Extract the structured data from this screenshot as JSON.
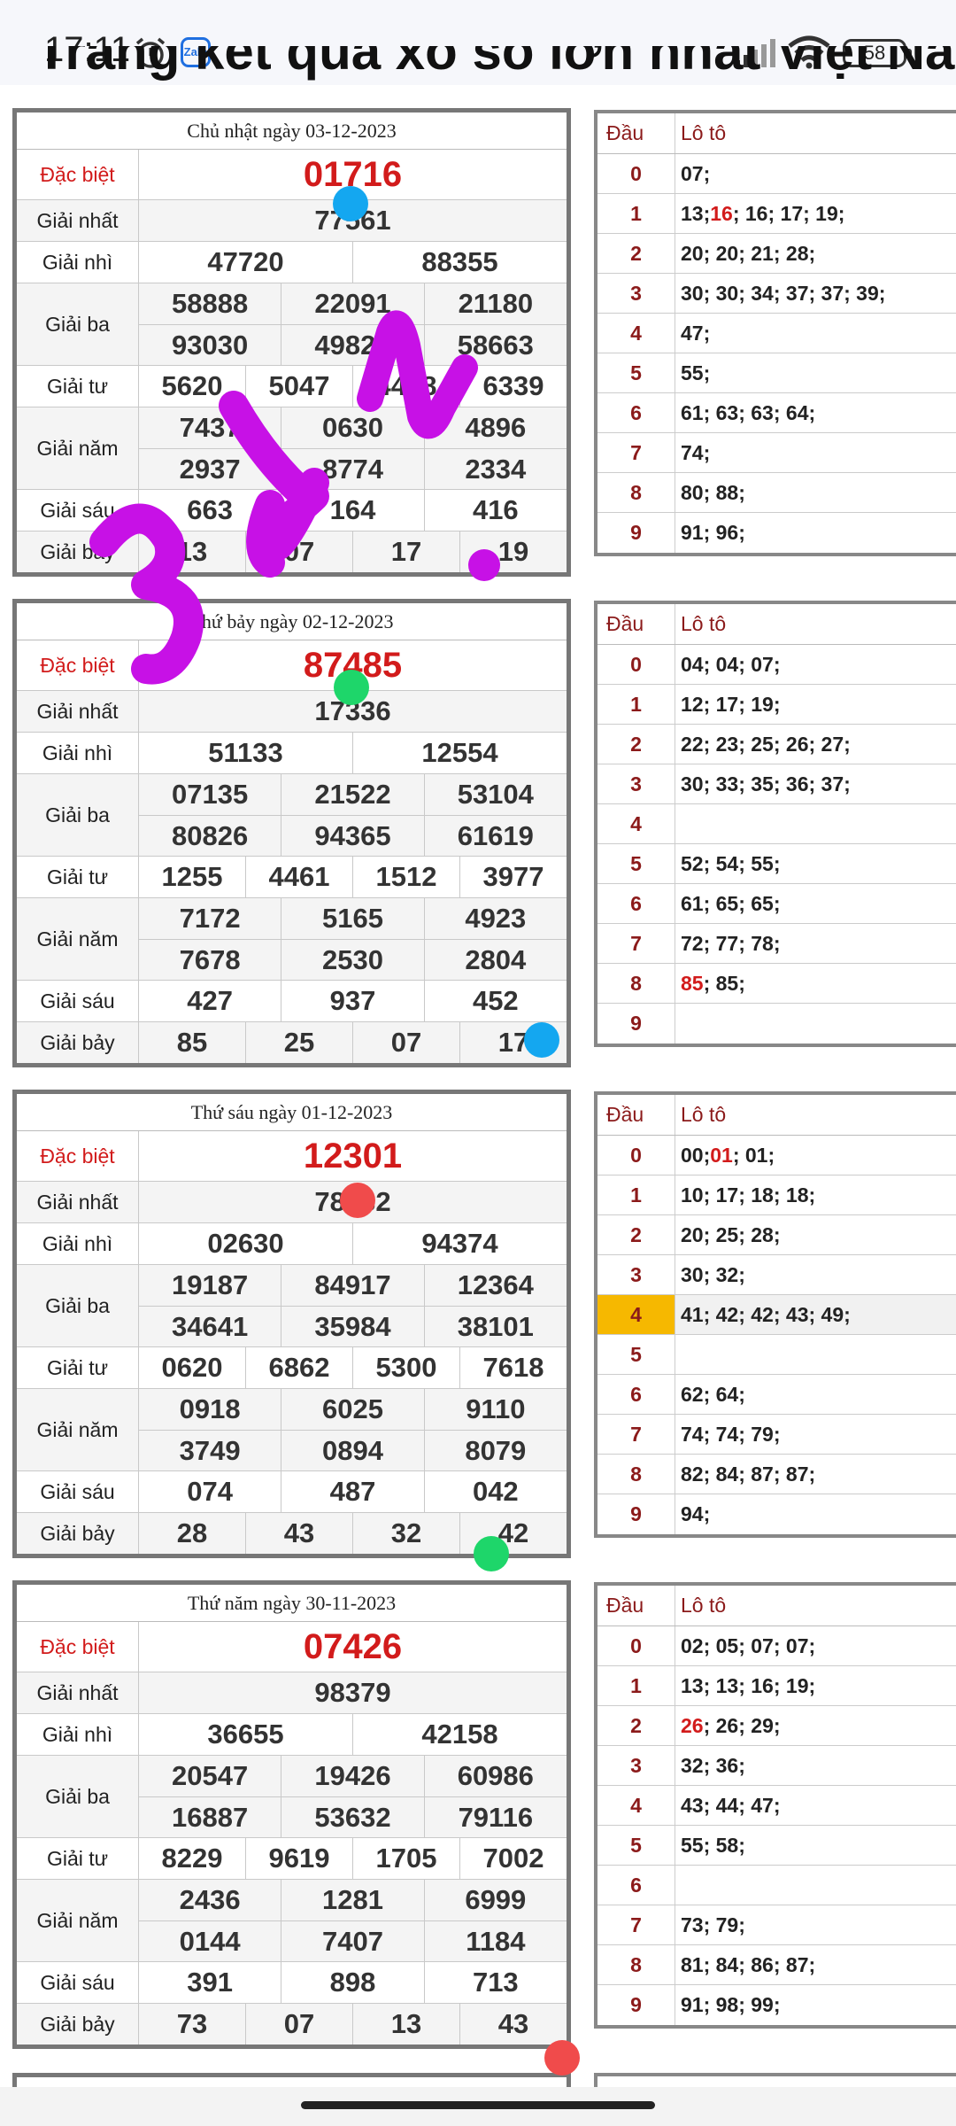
{
  "status_bar": {
    "time": "17:11",
    "battery": "58",
    "zalo_label": "Zalo"
  },
  "page_heading": "Trang kết quả xổ số lớn nhất Việt Nam",
  "loto_header": {
    "dau": "Đầu",
    "loto": "Lô tô"
  },
  "draws": [
    {
      "date": "Chủ nhật ngày 03-12-2023",
      "prizes": [
        {
          "label": "Đặc biệt",
          "rows": [
            [
              "01716"
            ]
          ]
        },
        {
          "label": "Giải nhất",
          "rows": [
            [
              "77561"
            ]
          ]
        },
        {
          "label": "Giải nhì",
          "rows": [
            [
              "47720",
              "88355"
            ]
          ]
        },
        {
          "label": "Giải ba",
          "rows": [
            [
              "58888",
              "22091",
              "21180"
            ],
            [
              "93030",
              "49829",
              "58663"
            ]
          ]
        },
        {
          "label": "Giải tư",
          "rows": [
            [
              "5620",
              "5047",
              "4468",
              "6339"
            ]
          ]
        },
        {
          "label": "Giải năm",
          "rows": [
            [
              "7437",
              "0630",
              "4896"
            ],
            [
              "2937",
              "8774",
              "2334"
            ]
          ]
        },
        {
          "label": "Giải sáu",
          "rows": [
            [
              "663",
              "164",
              "416"
            ]
          ]
        },
        {
          "label": "Giải bảy",
          "rows": [
            [
              "13",
              "07",
              "17",
              "19"
            ]
          ]
        }
      ],
      "loto": [
        {
          "d": "0",
          "v": [
            [
              "07;",
              false
            ]
          ]
        },
        {
          "d": "1",
          "v": [
            [
              "13; ",
              false
            ],
            [
              "16",
              true
            ],
            [
              "; 16; 17; 19;",
              false
            ]
          ]
        },
        {
          "d": "2",
          "v": [
            [
              "20; 20; 21; 28;",
              false
            ]
          ]
        },
        {
          "d": "3",
          "v": [
            [
              "30; 30; 34; 37; 37; 39;",
              false
            ]
          ]
        },
        {
          "d": "4",
          "v": [
            [
              "47;",
              false
            ]
          ]
        },
        {
          "d": "5",
          "v": [
            [
              "55;",
              false
            ]
          ]
        },
        {
          "d": "6",
          "v": [
            [
              "61; 63; 63; 64;",
              false
            ]
          ]
        },
        {
          "d": "7",
          "v": [
            [
              "74;",
              false
            ]
          ]
        },
        {
          "d": "8",
          "v": [
            [
              "80; 88;",
              false
            ]
          ]
        },
        {
          "d": "9",
          "v": [
            [
              "91; 96;",
              false
            ]
          ]
        }
      ]
    },
    {
      "date": "Thứ bảy ngày 02-12-2023",
      "prizes": [
        {
          "label": "Đặc biệt",
          "rows": [
            [
              "87485"
            ]
          ]
        },
        {
          "label": "Giải nhất",
          "rows": [
            [
              "17336"
            ]
          ]
        },
        {
          "label": "Giải nhì",
          "rows": [
            [
              "51133",
              "12554"
            ]
          ]
        },
        {
          "label": "Giải ba",
          "rows": [
            [
              "07135",
              "21522",
              "53104"
            ],
            [
              "80826",
              "94365",
              "61619"
            ]
          ]
        },
        {
          "label": "Giải tư",
          "rows": [
            [
              "1255",
              "4461",
              "1512",
              "3977"
            ]
          ]
        },
        {
          "label": "Giải năm",
          "rows": [
            [
              "7172",
              "5165",
              "4923"
            ],
            [
              "7678",
              "2530",
              "2804"
            ]
          ]
        },
        {
          "label": "Giải sáu",
          "rows": [
            [
              "427",
              "937",
              "452"
            ]
          ]
        },
        {
          "label": "Giải bảy",
          "rows": [
            [
              "85",
              "25",
              "07",
              "17"
            ]
          ]
        }
      ],
      "loto": [
        {
          "d": "0",
          "v": [
            [
              "04; 04; 07;",
              false
            ]
          ]
        },
        {
          "d": "1",
          "v": [
            [
              "12; 17; 19;",
              false
            ]
          ]
        },
        {
          "d": "2",
          "v": [
            [
              "22; 23; 25; 26; 27;",
              false
            ]
          ]
        },
        {
          "d": "3",
          "v": [
            [
              "30; 33; 35; 36; 37;",
              false
            ]
          ]
        },
        {
          "d": "4",
          "v": []
        },
        {
          "d": "5",
          "v": [
            [
              "52; 54; 55;",
              false
            ]
          ]
        },
        {
          "d": "6",
          "v": [
            [
              "61; 65; 65;",
              false
            ]
          ]
        },
        {
          "d": "7",
          "v": [
            [
              "72; 77; 78;",
              false
            ]
          ]
        },
        {
          "d": "8",
          "v": [
            [
              "85",
              true
            ],
            [
              "; 85;",
              false
            ]
          ]
        },
        {
          "d": "9",
          "v": []
        }
      ]
    },
    {
      "date": "Thứ sáu ngày 01-12-2023",
      "prizes": [
        {
          "label": "Đặc biệt",
          "rows": [
            [
              "12301"
            ]
          ]
        },
        {
          "label": "Giải nhất",
          "rows": [
            [
              "78432"
            ]
          ]
        },
        {
          "label": "Giải nhì",
          "rows": [
            [
              "02630",
              "94374"
            ]
          ]
        },
        {
          "label": "Giải ba",
          "rows": [
            [
              "19187",
              "84917",
              "12364"
            ],
            [
              "34641",
              "35984",
              "38101"
            ]
          ]
        },
        {
          "label": "Giải tư",
          "rows": [
            [
              "0620",
              "6862",
              "5300",
              "7618"
            ]
          ]
        },
        {
          "label": "Giải năm",
          "rows": [
            [
              "0918",
              "6025",
              "9110"
            ],
            [
              "3749",
              "0894",
              "8079"
            ]
          ]
        },
        {
          "label": "Giải sáu",
          "rows": [
            [
              "074",
              "487",
              "042"
            ]
          ]
        },
        {
          "label": "Giải bảy",
          "rows": [
            [
              "28",
              "43",
              "32",
              "42"
            ]
          ]
        }
      ],
      "loto": [
        {
          "d": "0",
          "v": [
            [
              "00; ",
              false
            ],
            [
              "01",
              true
            ],
            [
              "; 01;",
              false
            ]
          ]
        },
        {
          "d": "1",
          "v": [
            [
              "10; 17; 18; 18;",
              false
            ]
          ]
        },
        {
          "d": "2",
          "v": [
            [
              "20; 25; 28;",
              false
            ]
          ]
        },
        {
          "d": "3",
          "v": [
            [
              "30; 32;",
              false
            ]
          ]
        },
        {
          "d": "4",
          "v": [
            [
              "41; 42; 42; 43; 49;",
              false
            ]
          ],
          "active": true
        },
        {
          "d": "5",
          "v": []
        },
        {
          "d": "6",
          "v": [
            [
              "62; 64;",
              false
            ]
          ]
        },
        {
          "d": "7",
          "v": [
            [
              "74; 74; 79;",
              false
            ]
          ]
        },
        {
          "d": "8",
          "v": [
            [
              "82; 84; 87; 87;",
              false
            ]
          ]
        },
        {
          "d": "9",
          "v": [
            [
              "94;",
              false
            ]
          ]
        }
      ]
    },
    {
      "date": "Thứ năm ngày 30-11-2023",
      "prizes": [
        {
          "label": "Đặc biệt",
          "rows": [
            [
              "07426"
            ]
          ]
        },
        {
          "label": "Giải nhất",
          "rows": [
            [
              "98379"
            ]
          ]
        },
        {
          "label": "Giải nhì",
          "rows": [
            [
              "36655",
              "42158"
            ]
          ]
        },
        {
          "label": "Giải ba",
          "rows": [
            [
              "20547",
              "19426",
              "60986"
            ],
            [
              "16887",
              "53632",
              "79116"
            ]
          ]
        },
        {
          "label": "Giải tư",
          "rows": [
            [
              "8229",
              "9619",
              "1705",
              "7002"
            ]
          ]
        },
        {
          "label": "Giải năm",
          "rows": [
            [
              "2436",
              "1281",
              "6999"
            ],
            [
              "0144",
              "7407",
              "1184"
            ]
          ]
        },
        {
          "label": "Giải sáu",
          "rows": [
            [
              "391",
              "898",
              "713"
            ]
          ]
        },
        {
          "label": "Giải bảy",
          "rows": [
            [
              "73",
              "07",
              "13",
              "43"
            ]
          ]
        }
      ],
      "loto": [
        {
          "d": "0",
          "v": [
            [
              "02; 05; 07; 07;",
              false
            ]
          ]
        },
        {
          "d": "1",
          "v": [
            [
              "13; 13; 16; 19;",
              false
            ]
          ]
        },
        {
          "d": "2",
          "v": [
            [
              "26",
              true
            ],
            [
              "; 26; 29;",
              false
            ]
          ]
        },
        {
          "d": "3",
          "v": [
            [
              "32; 36;",
              false
            ]
          ]
        },
        {
          "d": "4",
          "v": [
            [
              "43; 44; 47;",
              false
            ]
          ]
        },
        {
          "d": "5",
          "v": [
            [
              "55; 58;",
              false
            ]
          ]
        },
        {
          "d": "6",
          "v": []
        },
        {
          "d": "7",
          "v": [
            [
              "73; 79;",
              false
            ]
          ]
        },
        {
          "d": "8",
          "v": [
            [
              "81; 84; 86; 87;",
              false
            ]
          ]
        },
        {
          "d": "9",
          "v": [
            [
              "91; 98; 99;",
              false
            ]
          ]
        }
      ]
    }
  ],
  "colors": {
    "accent_red": "#d21b1b",
    "loto_header": "#8b1a1a",
    "active_digit": "#f6b800",
    "scribble": "#c711e6",
    "dot_blue": "#14a7f0",
    "dot_green": "#1ed66a",
    "dot_red": "#f04b4b"
  }
}
